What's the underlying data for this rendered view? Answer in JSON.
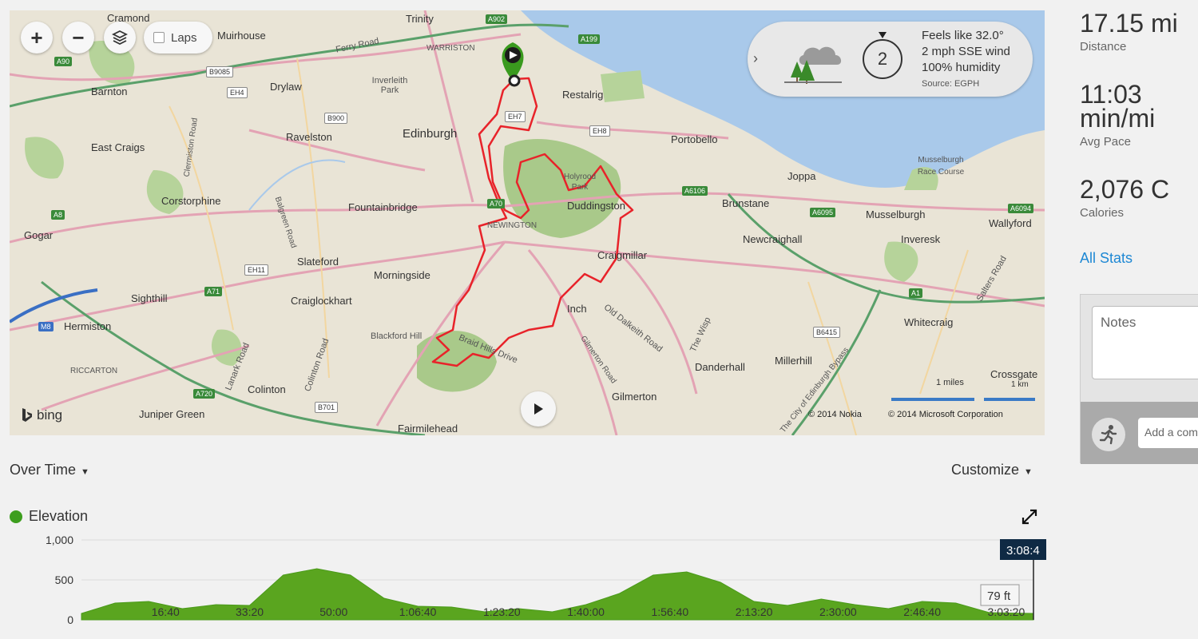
{
  "map": {
    "controls": {
      "zoom_in": "+",
      "zoom_out": "−",
      "laps_label": "Laps"
    },
    "weather": {
      "feels_like": "Feels like 32.0°",
      "wind": "2 mph SSE wind",
      "humidity": "100% humidity",
      "source": "Source: EGPH",
      "wind_speed": "2"
    },
    "places_large": [
      "Edinburgh"
    ],
    "places": [
      "Cramond",
      "Muirhouse",
      "Trinity",
      "Barnton",
      "Drylaw",
      "Inverleith Park",
      "Restalrig",
      "Ravelston",
      "Portobello",
      "East Craigs",
      "Corstorphine",
      "Fountainbridge",
      "Duddingston",
      "Joppa",
      "Brunstane",
      "Musselburgh",
      "Wallyford",
      "Gogar",
      "Slateford",
      "Newcraighall",
      "Inveresk",
      "Morningside",
      "Craigmillar",
      "Sighthill",
      "Craiglockhart",
      "Hermiston",
      "Inch",
      "Whitecraig",
      "Blackford Hill",
      "Danderhall",
      "Millerhill",
      "Colinton",
      "Gilmerton",
      "Juniper Green",
      "Fairmilehead",
      "Crossgate",
      "Musselburgh Race Course",
      "Holyrood Park"
    ],
    "roads": [
      "Ferry Road",
      "Braid Hills Drive",
      "Old Dalkeith Road",
      "The Wisp",
      "Lanark Road",
      "Colinton Road",
      "Gilmerton Road",
      "Salters Road",
      "Clermiston Road",
      "Balgreen Road",
      "The City of Edinburgh Bypass"
    ],
    "small_labels": [
      "WARRISTON",
      "NEWINGTON",
      "RICCARTON"
    ],
    "shields": [
      "A902",
      "A199",
      "A90",
      "B9085",
      "EH4",
      "B900",
      "EH7",
      "EH8",
      "A6106",
      "A6095",
      "A6094",
      "A8",
      "A70",
      "EH11",
      "A71",
      "A1",
      "M8",
      "B6415",
      "A720",
      "B701"
    ],
    "attribution": "bing",
    "copyright_nokia": "© 2014 Nokia",
    "copyright_ms": "© 2014 Microsoft Corporation",
    "scale_miles": "1 miles",
    "scale_km": "1 km"
  },
  "stats": {
    "distance_value": "17.15 mi",
    "distance_label": "Distance",
    "pace_value_1": "11:03",
    "pace_value_2": "min/mi",
    "pace_label": "Avg Pace",
    "calories_value": "2,076 C",
    "calories_label": "Calories",
    "all_stats": "All Stats"
  },
  "notes": {
    "placeholder": "Notes",
    "comment_placeholder": "Add a com"
  },
  "chart_controls": {
    "over_time": "Over Time",
    "customize": "Customize"
  },
  "chart_data": {
    "type": "area",
    "legend": "Elevation",
    "color": "#5aa51f",
    "ylim": [
      0,
      1000
    ],
    "yticks": [
      "1,000",
      "500",
      "0"
    ],
    "xticks": [
      "16:40",
      "33:20",
      "50:00",
      "1:06:40",
      "1:23:20",
      "1:40:00",
      "1:56:40",
      "2:13:20",
      "2:30:00",
      "2:46:40",
      "3:03:20"
    ],
    "duration_seconds": 11324,
    "cursor_time": "3:08:4",
    "cursor_value": "79 ft",
    "samples_seconds": [
      0,
      400,
      800,
      1200,
      1600,
      2000,
      2400,
      2800,
      3200,
      3600,
      4000,
      4400,
      4800,
      5200,
      5600,
      6000,
      6400,
      6800,
      7200,
      7600,
      8000,
      8400,
      8800,
      9200,
      9600,
      10000,
      10400,
      10800,
      11324
    ],
    "samples_elevation": [
      80,
      210,
      230,
      140,
      190,
      180,
      560,
      640,
      560,
      270,
      170,
      160,
      100,
      140,
      100,
      190,
      330,
      560,
      600,
      470,
      230,
      180,
      260,
      190,
      140,
      230,
      210,
      90,
      80
    ]
  }
}
